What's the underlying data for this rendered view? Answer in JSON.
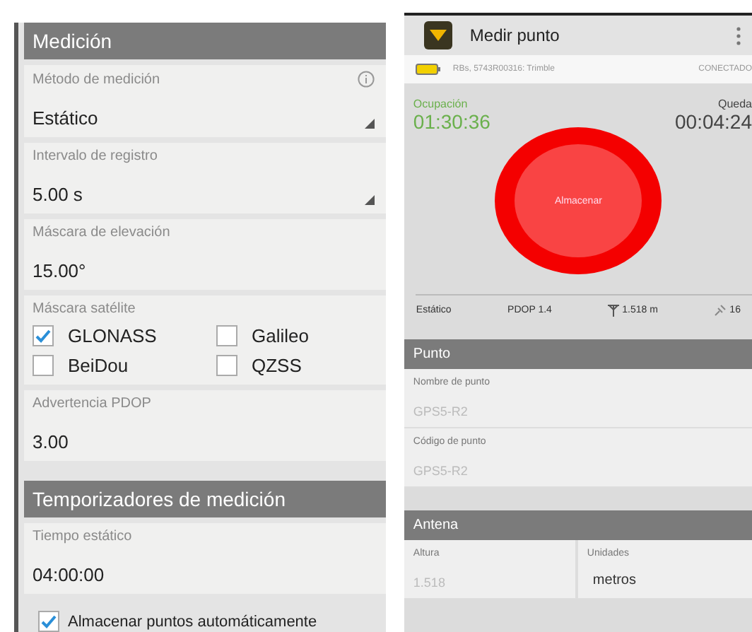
{
  "settings": {
    "sections": [
      {
        "title": "Medición",
        "items": [
          {
            "kind": "dropdown",
            "label": "Método de medición",
            "value": "Estático",
            "info": true
          },
          {
            "kind": "dropdown",
            "label": "Intervalo de registro",
            "value": "5.00 s",
            "info": false
          },
          {
            "kind": "text",
            "label": "Máscara de elevación",
            "value": "15.00°"
          },
          {
            "kind": "checks",
            "label": "Máscara satélite",
            "options": [
              {
                "label": "GLONASS",
                "checked": true
              },
              {
                "label": "Galileo",
                "checked": false
              },
              {
                "label": "BeiDou",
                "checked": false
              },
              {
                "label": "QZSS",
                "checked": false
              }
            ]
          },
          {
            "kind": "text",
            "label": "Advertencia PDOP",
            "value": "3.00"
          }
        ]
      },
      {
        "title": "Temporizadores de medición",
        "items": [
          {
            "kind": "text",
            "label": "Tiempo estático",
            "value": "04:00:00"
          }
        ]
      }
    ],
    "auto_store": {
      "label": "Almacenar puntos automáticamente",
      "checked": true
    }
  },
  "measure": {
    "title": "Medir punto",
    "receiver": "RBs, 5743R00316: Trimble",
    "connection": "CONECTADO",
    "occupation": {
      "label": "Ocupación",
      "time": "01:30:36"
    },
    "remaining": {
      "label": "Queda",
      "time": "00:04:24"
    },
    "store_button": "Almacenar",
    "stats": [
      {
        "kind": "text",
        "value": "Estático"
      },
      {
        "kind": "text",
        "value": "PDOP 1.4"
      },
      {
        "kind": "antenna",
        "value": "1.518 m"
      },
      {
        "kind": "satellites",
        "value": "16"
      }
    ],
    "point": {
      "title": "Punto",
      "fields": [
        {
          "label": "Nombre de punto",
          "placeholder": "GPS5-R2"
        },
        {
          "label": "Código de punto",
          "placeholder": "GPS5-R2"
        }
      ]
    },
    "antenna": {
      "title": "Antena",
      "height": {
        "label": "Altura",
        "placeholder": "1.518"
      },
      "units": {
        "label": "Unidades",
        "value": "metros"
      }
    }
  }
}
